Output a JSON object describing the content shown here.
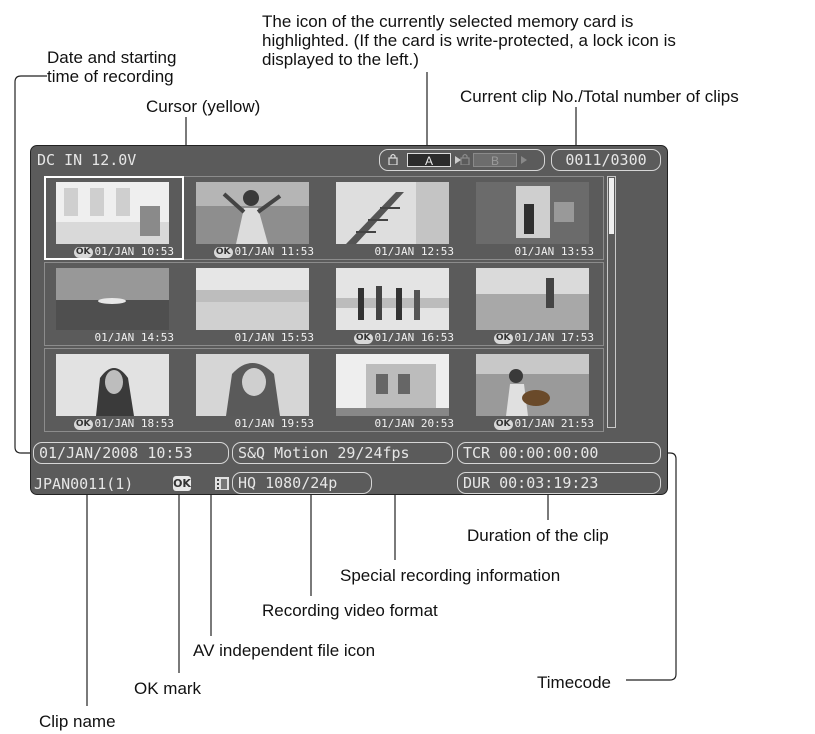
{
  "callouts": {
    "selected_card": [
      "The icon of the currently selected memory card is",
      "highlighted. (If the card is write-protected, a lock icon is",
      "displayed to the left.)"
    ],
    "date_time": [
      "Date and starting",
      "time of recording"
    ],
    "cursor": "Cursor (yellow)",
    "clip_count": "Current clip No./Total number of clips",
    "duration": "Duration of the clip",
    "special_rec": "Special recording information",
    "video_format": "Recording video format",
    "av_icon": "AV independent file icon",
    "ok_mark": "OK mark",
    "timecode": "Timecode",
    "clip_name": "Clip name"
  },
  "screen": {
    "power": "DC IN 12.0V",
    "slot_a": "A",
    "slot_b": "B",
    "clip_counter": "0011/0300",
    "start_datetime": "01/JAN/2008 10:53",
    "special_info": "S&Q Motion 29/24fps",
    "tcr": "TCR 00:00:00:00",
    "clip_name": "JPAN0011(1)",
    "ok_badge": "OK",
    "format": "HQ 1080/24p",
    "dur": "DUR 00:03:19:23"
  },
  "ok_label": "OK",
  "thumbnails": [
    {
      "time": "01/JAN 10:53",
      "ok": true,
      "selected": true,
      "scene": "room"
    },
    {
      "time": "01/JAN 11:53",
      "ok": true,
      "selected": false,
      "scene": "woman-arms"
    },
    {
      "time": "01/JAN 12:53",
      "ok": false,
      "selected": false,
      "scene": "stairs"
    },
    {
      "time": "01/JAN 13:53",
      "ok": false,
      "selected": false,
      "scene": "doorway"
    },
    {
      "time": "01/JAN 14:53",
      "ok": false,
      "selected": false,
      "scene": "sunset"
    },
    {
      "time": "01/JAN 15:53",
      "ok": false,
      "selected": false,
      "scene": "beach"
    },
    {
      "time": "01/JAN 16:53",
      "ok": true,
      "selected": false,
      "scene": "group"
    },
    {
      "time": "01/JAN 17:53",
      "ok": true,
      "selected": false,
      "scene": "sea"
    },
    {
      "time": "01/JAN 18:53",
      "ok": true,
      "selected": false,
      "scene": "portrait"
    },
    {
      "time": "01/JAN 19:53",
      "ok": false,
      "selected": false,
      "scene": "laughing"
    },
    {
      "time": "01/JAN 20:53",
      "ok": false,
      "selected": false,
      "scene": "building"
    },
    {
      "time": "01/JAN 21:53",
      "ok": true,
      "selected": false,
      "scene": "guitar"
    }
  ],
  "scrollbar_position": 0.0
}
